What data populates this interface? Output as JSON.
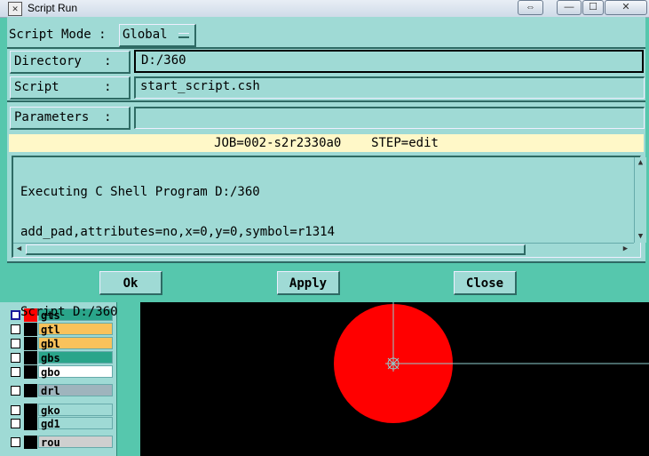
{
  "window": {
    "title": "Script Run"
  },
  "titlebar_buttons": {
    "restore": "⇔",
    "minimize": "—",
    "maximize": "☐",
    "close": "✕"
  },
  "script_mode": {
    "label": "Script Mode :",
    "value": "Global"
  },
  "directory": {
    "label": "Directory   :",
    "value": "D:/360"
  },
  "script": {
    "label": "Script      :",
    "value": "start_script.csh"
  },
  "parameters": {
    "label": "Parameters  :",
    "value": ""
  },
  "job_bar": {
    "text": "JOB=002-s2r2330a0    STEP=edit"
  },
  "console": {
    "lines": [
      "Executing C Shell Program D:/360",
      "add_pad,attributes=no,x=0,y=0,symbol=r1314",
      "",
      "Script D:/360"
    ]
  },
  "buttons": {
    "ok": "Ok",
    "apply": "Apply",
    "close": "Close"
  },
  "layers": [
    {
      "name": "gts",
      "color": "#2aa58a",
      "swatch": "#ff0000",
      "active": true
    },
    {
      "name": "gtl",
      "color": "#f9c25b",
      "swatch": "#000000",
      "active": false
    },
    {
      "name": "gbl",
      "color": "#f9c25b",
      "swatch": "#000000",
      "active": false
    },
    {
      "name": "gbs",
      "color": "#2aa58a",
      "swatch": "#000000",
      "active": false
    },
    {
      "name": "gbo",
      "color": "#ffffff",
      "swatch": "#000000",
      "active": false
    },
    {
      "name": "drl",
      "color": "#9fb4bd",
      "swatch": "#000000",
      "active": false
    },
    {
      "name": "gko",
      "color": "#9fdad5",
      "swatch": "#000000",
      "active": false
    },
    {
      "name": "gd1",
      "color": "#9fdad5",
      "swatch": "#000000",
      "active": false
    },
    {
      "name": "rou",
      "color": "#cfcfcf",
      "swatch": "#000000",
      "active": false
    }
  ],
  "colors": {
    "dialog_bg": "#9fdad5",
    "frame": "#56c7ad",
    "pad": "#ff0000",
    "job_bar": "#fff8c8"
  }
}
